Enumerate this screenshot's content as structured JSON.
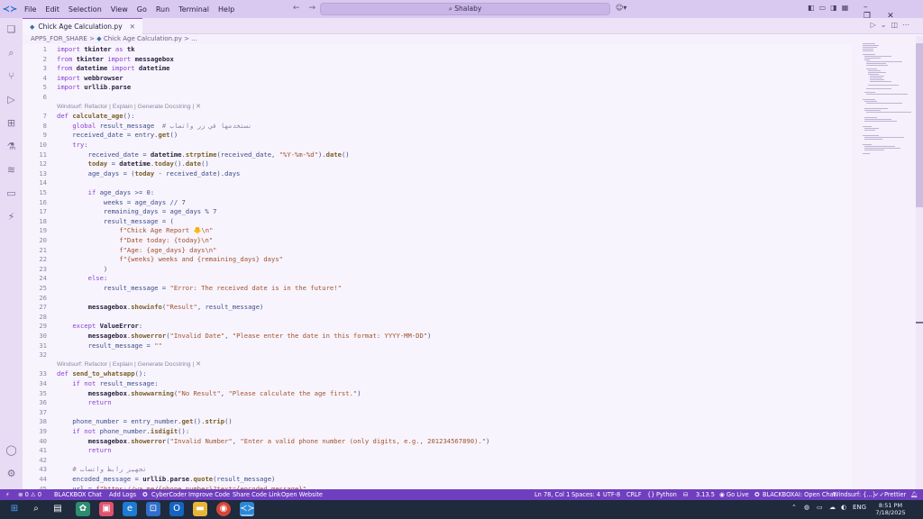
{
  "menubar": {
    "items": [
      "File",
      "Edit",
      "Selection",
      "View",
      "Go",
      "Run",
      "Terminal",
      "Help"
    ],
    "search_text": "Shalaby"
  },
  "tab": {
    "label": "Chick Age Calculation.py"
  },
  "breadcrumb": {
    "folder": "APPS_FOR_SHARE",
    "sep": ">",
    "file": "Chick Age Calculation.py",
    "more": "> ..."
  },
  "codelens": "Windsurf: Refactor | Explain | Generate Docstring | ✕",
  "code_lines": [
    {
      "n": "1",
      "t": "import tkinter as tk"
    },
    {
      "n": "2",
      "t": "from tkinter import messagebox"
    },
    {
      "n": "3",
      "t": "from datetime import datetime"
    },
    {
      "n": "4",
      "t": "import webbrowser"
    },
    {
      "n": "5",
      "t": "import urllib.parse"
    },
    {
      "n": "6",
      "t": ""
    },
    {
      "n": "7",
      "t": "def calculate_age():",
      "lens": true
    },
    {
      "n": "8",
      "t": "    global result_message  # نستخدمها في زر واتساب"
    },
    {
      "n": "9",
      "t": "    received_date = entry.get()"
    },
    {
      "n": "10",
      "t": "    try:"
    },
    {
      "n": "11",
      "t": "        received_date = datetime.strptime(received_date, \"%Y-%m-%d\").date()"
    },
    {
      "n": "12",
      "t": "        today = datetime.today().date()"
    },
    {
      "n": "13",
      "t": "        age_days = (today - received_date).days"
    },
    {
      "n": "14",
      "t": ""
    },
    {
      "n": "15",
      "t": "        if age_days >= 0:"
    },
    {
      "n": "16",
      "t": "            weeks = age_days // 7"
    },
    {
      "n": "17",
      "t": "            remaining_days = age_days % 7"
    },
    {
      "n": "18",
      "t": "            result_message = ("
    },
    {
      "n": "19",
      "t": "                f\"Chick Age Report 🐥\\n\""
    },
    {
      "n": "20",
      "t": "                f\"Date today: {today}\\n\""
    },
    {
      "n": "21",
      "t": "                f\"Age: {age_days} days\\n\""
    },
    {
      "n": "22",
      "t": "                f\"{weeks} weeks and {remaining_days} days\""
    },
    {
      "n": "23",
      "t": "            )"
    },
    {
      "n": "24",
      "t": "        else:"
    },
    {
      "n": "25",
      "t": "            result_message = \"Error: The received date is in the future!\""
    },
    {
      "n": "26",
      "t": ""
    },
    {
      "n": "27",
      "t": "        messagebox.showinfo(\"Result\", result_message)"
    },
    {
      "n": "28",
      "t": ""
    },
    {
      "n": "29",
      "t": "    except ValueError:"
    },
    {
      "n": "30",
      "t": "        messagebox.showerror(\"Invalid Date\", \"Please enter the date in this format: YYYY-MM-DD\")"
    },
    {
      "n": "31",
      "t": "        result_message = \"\""
    },
    {
      "n": "32",
      "t": ""
    },
    {
      "n": "33",
      "t": "def send_to_whatsapp():",
      "lens": true
    },
    {
      "n": "34",
      "t": "    if not result_message:"
    },
    {
      "n": "35",
      "t": "        messagebox.showwarning(\"No Result\", \"Please calculate the age first.\")"
    },
    {
      "n": "36",
      "t": "        return"
    },
    {
      "n": "37",
      "t": ""
    },
    {
      "n": "38",
      "t": "    phone_number = entry_number.get().strip()"
    },
    {
      "n": "39",
      "t": "    if not phone_number.isdigit():"
    },
    {
      "n": "40",
      "t": "        messagebox.showerror(\"Invalid Number\", \"Enter a valid phone number (only digits, e.g., 201234567890).\")"
    },
    {
      "n": "41",
      "t": "        return"
    },
    {
      "n": "42",
      "t": ""
    },
    {
      "n": "43",
      "t": "    # تجهيز رابط واتساب"
    },
    {
      "n": "44",
      "t": "    encoded_message = urllib.parse.quote(result_message)"
    },
    {
      "n": "45",
      "t": "    url = f\"https://wa.me/{phone_number}?text={encoded_message}\""
    }
  ],
  "statusbar": {
    "remote": "⚡",
    "problems": "⊗ 0 ⚠ 0",
    "blackbox": "BLACKBOX Chat",
    "addlogs": "Add Logs",
    "cybercoder": "CyberCoder",
    "improve": "Improve Code",
    "share": "Share Code Link",
    "website": "Open Website",
    "position": "Ln 78, Col 1",
    "spaces": "Spaces: 4",
    "encoding": "UTF-8",
    "eol": "CRLF",
    "language": "Python",
    "version": "3.13.5",
    "golive": "Go Live",
    "blackboxai": "BLACKBOXAI: Open Chat",
    "windsurf": "Windsurf: {...}",
    "prettier": "Prettier"
  },
  "taskbar": {
    "lang": "ENG",
    "time": "8:51 PM",
    "date": "7/18/2025"
  },
  "colors": {
    "accent": "#6f3fbf",
    "keyword": "#8a3fd1",
    "string": "#a0522d",
    "function": "#795e26",
    "comment": "#8e84a6"
  }
}
